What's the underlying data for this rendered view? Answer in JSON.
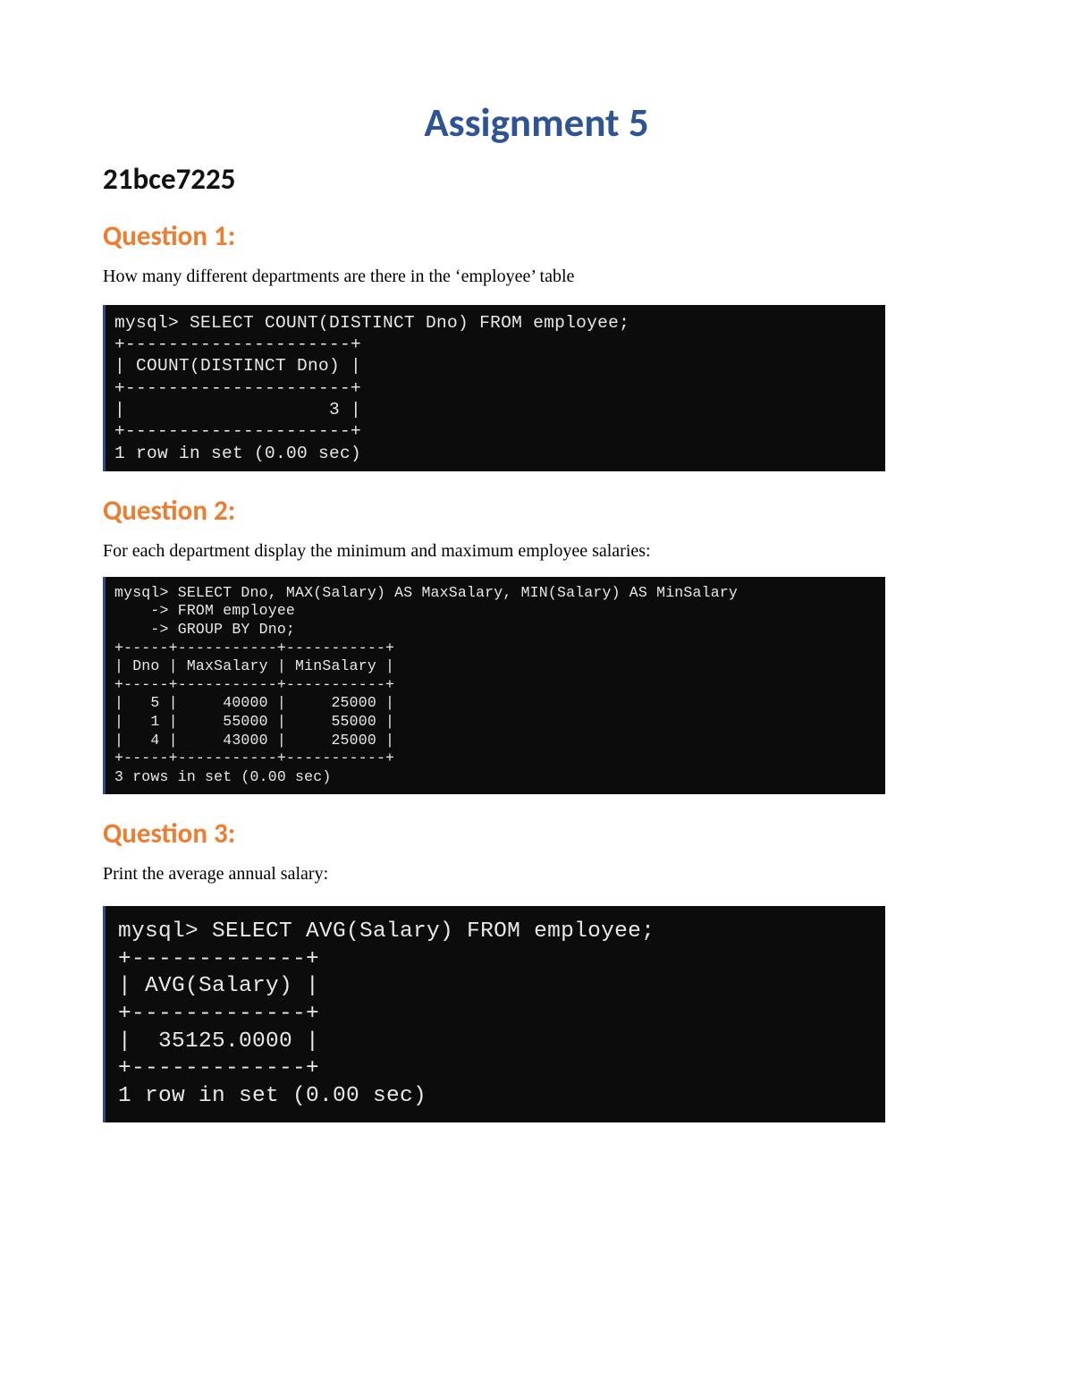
{
  "title": "Assignment 5",
  "student_id": "21bce7225",
  "questions": [
    {
      "heading": "Question 1:",
      "desc": "How many different departments are there in the ‘employee’ table",
      "terminal_class": "term1",
      "terminal": "mysql> SELECT COUNT(DISTINCT Dno) FROM employee;\n+---------------------+\n| COUNT(DISTINCT Dno) |\n+---------------------+\n|                   3 |\n+---------------------+\n1 row in set (0.00 sec)"
    },
    {
      "heading": "Question 2:",
      "desc": "For each department display the minimum and maximum employee salaries:",
      "terminal_class": "term2",
      "terminal": "mysql> SELECT Dno, MAX(Salary) AS MaxSalary, MIN(Salary) AS MinSalary\n    -> FROM employee\n    -> GROUP BY Dno;\n+-----+-----------+-----------+\n| Dno | MaxSalary | MinSalary |\n+-----+-----------+-----------+\n|   5 |     40000 |     25000 |\n|   1 |     55000 |     55000 |\n|   4 |     43000 |     25000 |\n+-----+-----------+-----------+\n3 rows in set (0.00 sec)"
    },
    {
      "heading": "Question 3:",
      "desc": "Print the average annual salary:",
      "terminal_class": "term3",
      "terminal": "mysql> SELECT AVG(Salary) FROM employee;\n+-------------+\n| AVG(Salary) |\n+-------------+\n|  35125.0000 |\n+-------------+\n1 row in set (0.00 sec)"
    }
  ]
}
